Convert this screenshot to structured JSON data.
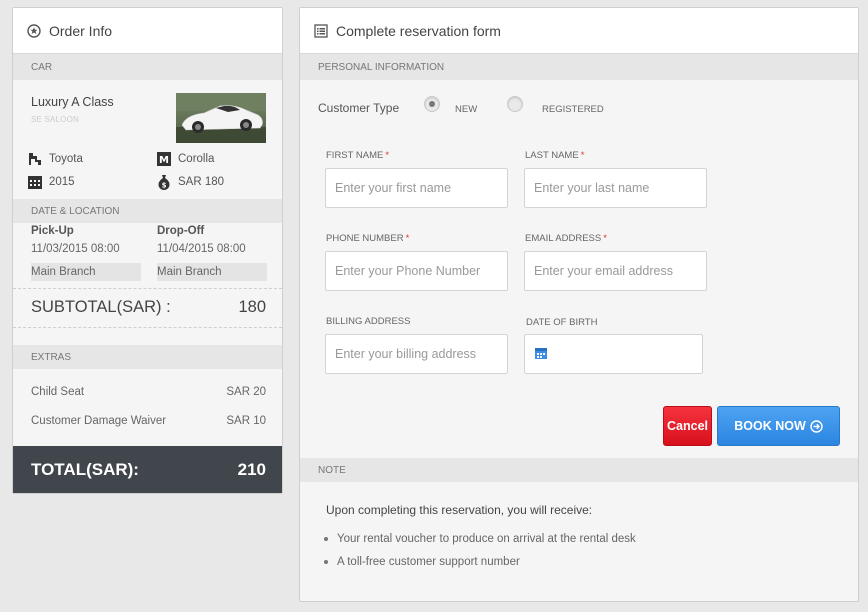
{
  "order": {
    "title": "Order Info",
    "car_section": "CAR",
    "car_name": "Luxury A Class",
    "car_sub": "SE SALOON",
    "brand": "Toyota",
    "model": "Corolla",
    "year": "2015",
    "price": "SAR 180",
    "date_section": "DATE & LOCATION",
    "pickup_label": "Pick-Up",
    "pickup_date": "11/03/2015 08:00",
    "pickup_branch": "Main Branch",
    "dropoff_label": "Drop-Off",
    "dropoff_date": "11/04/2015 08:00",
    "dropoff_branch": "Main Branch",
    "subtotal_label": "SUBTOTAL(SAR) :",
    "subtotal_value": "180",
    "extras_section": "EXTRAS",
    "extras": [
      {
        "label": "Child Seat",
        "value": "SAR 20"
      },
      {
        "label": "Customer Damage Waiver",
        "value": "SAR 10"
      }
    ],
    "total_label": "TOTAL(SAR):",
    "total_value": "210"
  },
  "form": {
    "title": "Complete reservation form",
    "personal_section": "PERSONAL INFORMATION",
    "customer_type_label": "Customer Type",
    "radio_new": "NEW",
    "radio_registered": "REGISTERED",
    "selected_type": "new",
    "first_name_label": "FIRST NAME",
    "first_name_placeholder": "Enter your first name",
    "last_name_label": "LAST NAME",
    "last_name_placeholder": "Enter your last name",
    "phone_label": "PHONE NUMBER",
    "phone_placeholder": "Enter your Phone Number",
    "email_label": "EMAIL ADDRESS",
    "email_placeholder": "Enter your email address",
    "billing_label": "BILLING ADDRESS",
    "billing_placeholder": "Enter your billing address",
    "dob_label": "DATE OF BIRTH",
    "required_mark": "*",
    "cancel_label": "Cancel",
    "book_label": "BOOK NOW",
    "note_section": "NOTE",
    "note_intro": "Upon completing this reservation, you will receive:",
    "note_items": [
      "Your rental voucher to produce on arrival at the rental desk",
      "A toll-free customer support number"
    ]
  },
  "colors": {
    "total_bar": "#41464d",
    "cancel": "#e01a26",
    "book": "#3593ea",
    "required": "#e0313a"
  }
}
